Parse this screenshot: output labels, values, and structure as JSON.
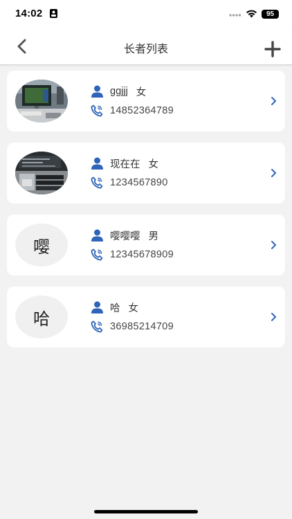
{
  "status_bar": {
    "time": "14:02",
    "battery": "95"
  },
  "nav": {
    "title": "长者列表"
  },
  "elders": [
    {
      "name": "ggjjj",
      "gender": "女",
      "phone": "14852364789",
      "avatar_type": "photo-desktop",
      "avatar_text": ""
    },
    {
      "name": "现在在",
      "gender": "女",
      "phone": "1234567890",
      "avatar_type": "photo-laptop",
      "avatar_text": ""
    },
    {
      "name": "嘤嘤嘤",
      "gender": "男",
      "phone": "12345678909",
      "avatar_type": "text",
      "avatar_text": "嘤"
    },
    {
      "name": "哈",
      "gender": "女",
      "phone": "36985214709",
      "avatar_type": "text",
      "avatar_text": "哈"
    }
  ],
  "icons": {
    "back": "chevron-left-icon",
    "add": "plus-icon",
    "person": "person-icon",
    "phone": "phone-icon",
    "row_arrow": "chevron-right-icon"
  },
  "colors": {
    "accent": "#2f64b8",
    "background": "#f2f2f2",
    "card": "#ffffff",
    "nav_icon": "#555555"
  }
}
